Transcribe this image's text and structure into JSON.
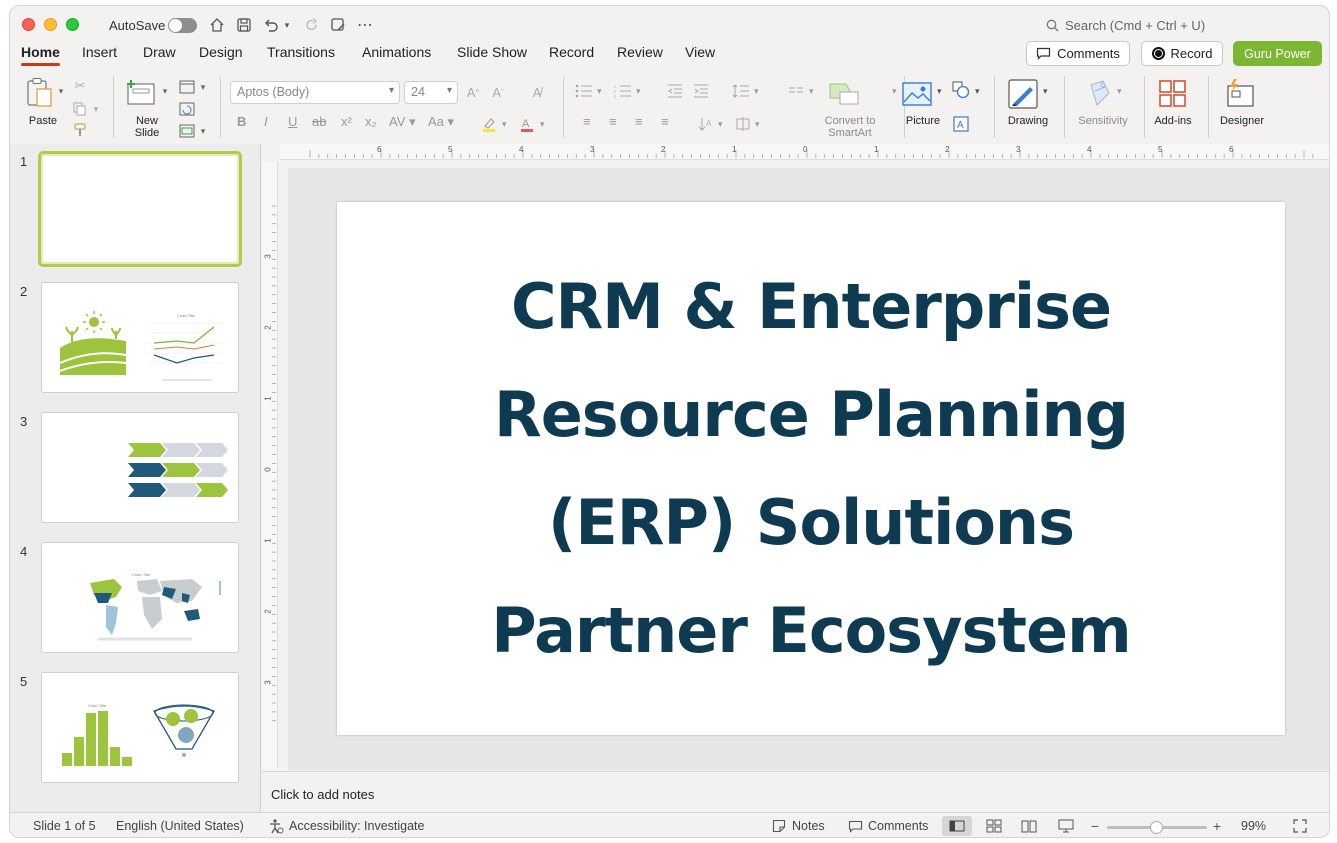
{
  "titlebar": {
    "autosave_label": "AutoSave",
    "search_placeholder": "Search (Cmd + Ctrl + U)"
  },
  "tabs": [
    "Home",
    "Insert",
    "Draw",
    "Design",
    "Transitions",
    "Animations",
    "Slide Show",
    "Record",
    "Review",
    "View"
  ],
  "actions": {
    "comments": "Comments",
    "record": "Record",
    "guru": "Guru Power"
  },
  "ribbon": {
    "paste": "Paste",
    "new_slide_line1": "New",
    "new_slide_line2": "Slide",
    "font_name": "Aptos (Body)",
    "font_size": "24",
    "convert_line1": "Convert to",
    "convert_line2": "SmartArt",
    "picture": "Picture",
    "drawing": "Drawing",
    "sensitivity": "Sensitivity",
    "addins": "Add-ins",
    "designer": "Designer",
    "accent_green": "#8dc63f",
    "brand_color": "#c43e1c"
  },
  "thumbnails": {
    "numbers": [
      "1",
      "2",
      "3",
      "4",
      "5"
    ]
  },
  "ruler": {
    "h_labels": [
      "6",
      "5",
      "4",
      "3",
      "2",
      "1",
      "0",
      "1",
      "2",
      "3",
      "4",
      "5",
      "6"
    ],
    "v_labels": [
      "3",
      "2",
      "1",
      "0",
      "1",
      "2",
      "3"
    ]
  },
  "slide": {
    "title_lines": [
      "CRM & Enterprise",
      "Resource Planning",
      "(ERP) Solutions",
      "Partner Ecosystem"
    ],
    "title_color": "#0e3a52"
  },
  "notes": {
    "placeholder": "Click to add notes"
  },
  "status": {
    "slide_info": "Slide 1 of 5",
    "language": "English (United States)",
    "accessibility": "Accessibility: Investigate",
    "notes": "Notes",
    "comments": "Comments",
    "zoom": "99%",
    "zoom_fraction": 0.49
  }
}
